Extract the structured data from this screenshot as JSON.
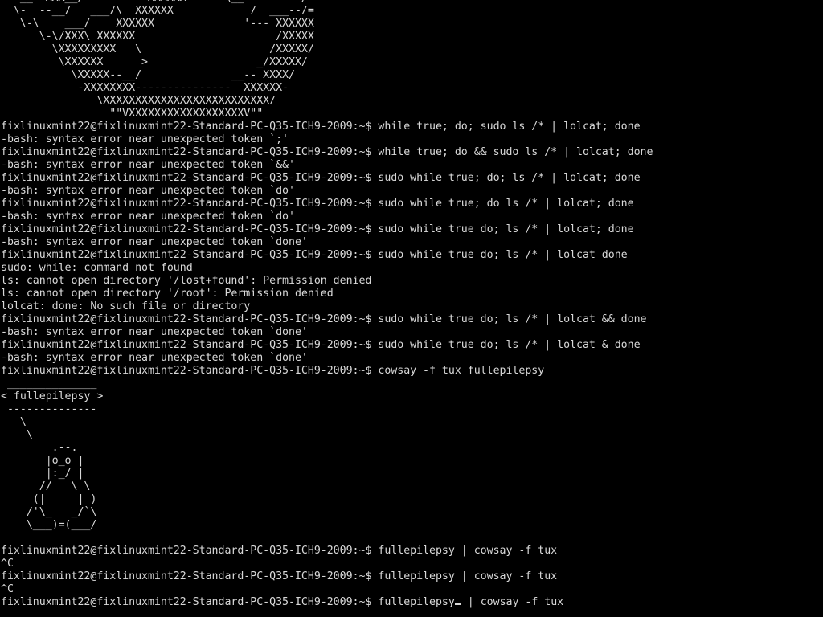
{
  "terminal": {
    "lines": [
      "---__  XXX__/          XXXXXX      \\__         /",
      "  \\-  --__/   ___/\\  XXXXXX            /  ___--/=",
      "   \\-\\    ___/    XXXXXX              '--- XXXXXX",
      "      \\-\\/XXX\\ XXXXXX                      /XXXXX",
      "        \\XXXXXXXXX   \\                    /XXXXX/",
      "         \\XXXXXX      >                 _/XXXXX/",
      "           \\XXXXX--__/              __-- XXXX/",
      "            -XXXXXXXX---------------  XXXXXX-",
      "               \\XXXXXXXXXXXXXXXXXXXXXXXXXX/",
      "                 \"\"VXXXXXXXXXXXXXXXXXXV\"\"",
      "fixlinuxmint22@fixlinuxmint22-Standard-PC-Q35-ICH9-2009:~$ while true; do; sudo ls /* | lolcat; done",
      "-bash: syntax error near unexpected token `;'",
      "fixlinuxmint22@fixlinuxmint22-Standard-PC-Q35-ICH9-2009:~$ while true; do && sudo ls /* | lolcat; done",
      "-bash: syntax error near unexpected token `&&'",
      "fixlinuxmint22@fixlinuxmint22-Standard-PC-Q35-ICH9-2009:~$ sudo while true; do; ls /* | lolcat; done",
      "-bash: syntax error near unexpected token `do'",
      "fixlinuxmint22@fixlinuxmint22-Standard-PC-Q35-ICH9-2009:~$ sudo while true; do ls /* | lolcat; done",
      "-bash: syntax error near unexpected token `do'",
      "fixlinuxmint22@fixlinuxmint22-Standard-PC-Q35-ICH9-2009:~$ sudo while true do; ls /* | lolcat; done",
      "-bash: syntax error near unexpected token `done'",
      "fixlinuxmint22@fixlinuxmint22-Standard-PC-Q35-ICH9-2009:~$ sudo while true do; ls /* | lolcat done",
      "sudo: while: command not found",
      "ls: cannot open directory '/lost+found': Permission denied",
      "ls: cannot open directory '/root': Permission denied",
      "lolcat: done: No such file or directory",
      "fixlinuxmint22@fixlinuxmint22-Standard-PC-Q35-ICH9-2009:~$ sudo while true do; ls /* | lolcat && done",
      "-bash: syntax error near unexpected token `done'",
      "fixlinuxmint22@fixlinuxmint22-Standard-PC-Q35-ICH9-2009:~$ sudo while true do; ls /* | lolcat & done",
      "-bash: syntax error near unexpected token `done'",
      "fixlinuxmint22@fixlinuxmint22-Standard-PC-Q35-ICH9-2009:~$ cowsay -f tux fullepilepsy",
      " ______________",
      "< fullepilepsy >",
      " --------------",
      "   \\",
      "    \\",
      "        .--.",
      "       |o_o |",
      "       |:_/ |",
      "      //   \\ \\",
      "     (|     | )",
      "    /'\\_   _/`\\",
      "    \\___)=(___/",
      "",
      "fixlinuxmint22@fixlinuxmint22-Standard-PC-Q35-ICH9-2009:~$ fullepilepsy | cowsay -f tux",
      "^C",
      "fixlinuxmint22@fixlinuxmint22-Standard-PC-Q35-ICH9-2009:~$ fullepilepsy | cowsay -f tux",
      "^C"
    ],
    "current_prompt": "fixlinuxmint22@fixlinuxmint22-Standard-PC-Q35-ICH9-2009:~$ fullepilepsy",
    "current_input_rest": " | cowsay -f tux"
  }
}
